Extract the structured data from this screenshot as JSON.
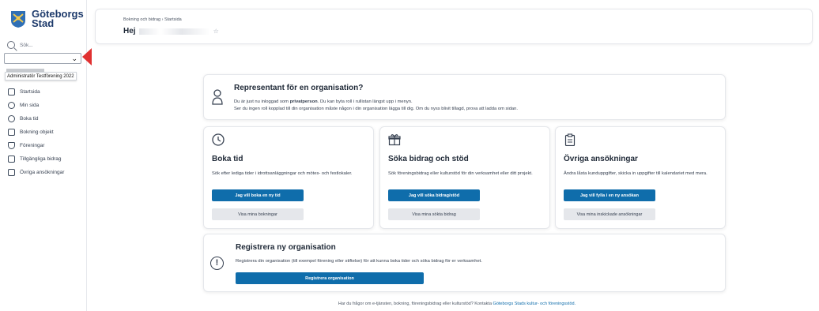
{
  "sidebar": {
    "logo_line1": "Göteborgs",
    "logo_line2": "Stad",
    "search_placeholder": "Sök...",
    "role_tooltip": "Administratör Testförening 2022",
    "nav": [
      {
        "label": "Startsida",
        "icon": "home-icon"
      },
      {
        "label": "Min sida",
        "icon": "user-circle-icon"
      },
      {
        "label": "Boka tid",
        "icon": "clock-icon"
      },
      {
        "label": "Bokning objekt",
        "icon": "building-icon"
      },
      {
        "label": "Föreningar",
        "icon": "shield-icon"
      },
      {
        "label": "Tillgängliga bidrag",
        "icon": "gift-icon"
      },
      {
        "label": "Övriga ansökningar",
        "icon": "clipboard-icon"
      }
    ]
  },
  "header": {
    "breadcrumb": "Bokning och bidrag › Startsida",
    "greeting": "Hej"
  },
  "representative": {
    "title": "Representant för en organisation?",
    "line1_pre": "Du är just nu inloggad som",
    "line1_bold": "privatperson",
    "line1_post": ". Du kan byta roll i rullistan längst upp i menyn.",
    "line2": "Ser du ingen roll kopplad till din organisation måste någon i din organisation lägga till dig. Om du nyss blivit tillagd, prova att ladda om sidan."
  },
  "services": [
    {
      "icon": "clock-icon",
      "title": "Boka tid",
      "description": "Sök efter lediga tider i idrottsanläggningar och mötes- och festlokaler.",
      "primary": "Jag vill boka en ny tid",
      "secondary": "Visa mina bokningar"
    },
    {
      "icon": "gift-icon",
      "title": "Söka bidrag och stöd",
      "description": "Sök föreningsbidrag eller kulturstöd för din verksamhet eller ditt projekt.",
      "primary": "Jag vill söka bidrag/stöd",
      "secondary": "Visa mina sökta bidrag"
    },
    {
      "icon": "clipboard-icon",
      "title": "Övriga ansökningar",
      "description": "Ändra låsta kunduppgifter, skicka in uppgifter till kalendariet med mera.",
      "primary": "Jag vill fylla i en ny ansökan",
      "secondary": "Visa mina inskickade ansökningar"
    }
  ],
  "register": {
    "title": "Registrera ny organisation",
    "description": "Registrera din organisation (till exempel förening eller stiftelse) för att kunna boka tider och söka bidrag för er verksamhet.",
    "button": "Registrera organisation"
  },
  "footer": {
    "text": "Har du frågor om e-tjänsten, bokning, föreningsbidrag eller kulturstöd? Kontakta",
    "link": "Göteborgs Stads kultur- och föreningsstöd."
  },
  "colors": {
    "primary_button": "#0f6dab",
    "secondary_button": "#e5e7eb",
    "brand_blue": "#1d3a6b",
    "annotation_arrow": "#e03131"
  }
}
